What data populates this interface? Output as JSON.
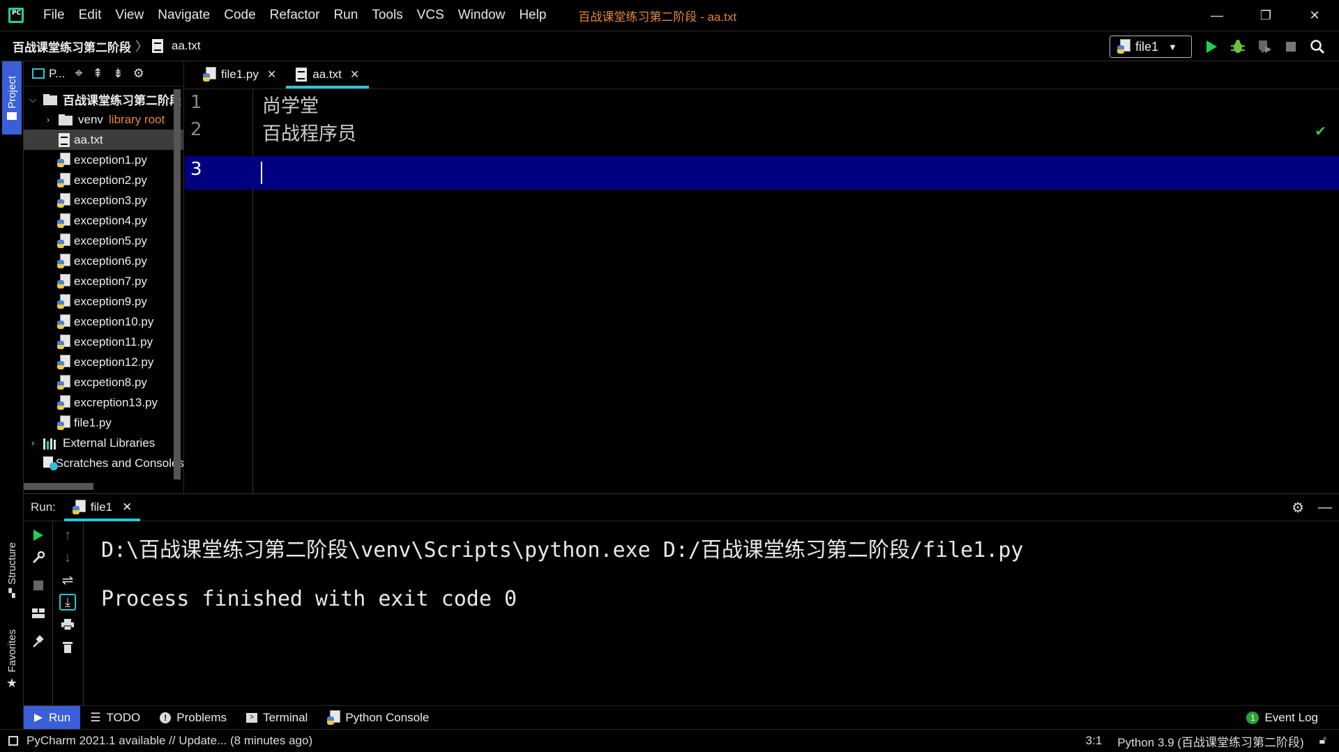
{
  "app": {
    "logo_text": "PC",
    "window_title": "百战课堂练习第二阶段 - aa.txt"
  },
  "menu": [
    "File",
    "Edit",
    "View",
    "Navigate",
    "Code",
    "Refactor",
    "Run",
    "Tools",
    "VCS",
    "Window",
    "Help"
  ],
  "window_controls": {
    "minimize": "—",
    "restore": "❐",
    "close": "✕"
  },
  "breadcrumb": {
    "project": "百战课堂练习第二阶段",
    "file": "aa.txt"
  },
  "run_config": {
    "name": "file1"
  },
  "left_stripe": {
    "project": "Project",
    "structure": "Structure",
    "favorites": "Favorites"
  },
  "project_panel": {
    "view_label": "P...",
    "tree": [
      {
        "label": "百战课堂练习第二阶段",
        "type": "folder",
        "expanded": true
      },
      {
        "label": "venv",
        "suffix": "library root",
        "type": "folder",
        "expanded": false
      },
      {
        "label": "aa.txt",
        "type": "txt",
        "selected": true
      },
      {
        "label": "exception1.py",
        "type": "py"
      },
      {
        "label": "exception2.py",
        "type": "py"
      },
      {
        "label": "exception3.py",
        "type": "py"
      },
      {
        "label": "exception4.py",
        "type": "py"
      },
      {
        "label": "exception5.py",
        "type": "py"
      },
      {
        "label": "exception6.py",
        "type": "py"
      },
      {
        "label": "exception7.py",
        "type": "py"
      },
      {
        "label": "exception9.py",
        "type": "py"
      },
      {
        "label": "exception10.py",
        "type": "py"
      },
      {
        "label": "exception11.py",
        "type": "py"
      },
      {
        "label": "exception12.py",
        "type": "py"
      },
      {
        "label": "excpetion8.py",
        "type": "py"
      },
      {
        "label": "excreption13.py",
        "type": "py"
      },
      {
        "label": "file1.py",
        "type": "py"
      },
      {
        "label": "External Libraries",
        "type": "lib"
      },
      {
        "label": "Scratches and Consoles",
        "type": "scratch"
      }
    ]
  },
  "editor": {
    "tabs": [
      {
        "label": "file1.py",
        "close": "✕"
      },
      {
        "label": "aa.txt",
        "close": "✕"
      }
    ],
    "line_numbers": [
      "1",
      "2",
      "3"
    ],
    "lines": [
      "尚学堂",
      "百战程序员",
      ""
    ],
    "status_check": "✔"
  },
  "run_panel": {
    "label": "Run:",
    "tab": "file1",
    "tab_close": "✕",
    "console": [
      "D:\\百战课堂练习第二阶段\\venv\\Scripts\\python.exe D:/百战课堂练习第二阶段/file1.py",
      "",
      "Process finished with exit code 0"
    ]
  },
  "tool_strip": {
    "run": "Run",
    "todo": "TODO",
    "problems": "Problems",
    "terminal": "Terminal",
    "python_console": "Python Console",
    "event_log": "Event Log",
    "event_count": "1"
  },
  "status_bar": {
    "message": "PyCharm 2021.1 available // Update... (8 minutes ago)",
    "position": "3:1",
    "interpreter": "Python 3.9 (百战课堂练习第二阶段)"
  },
  "colors": {
    "accent_tab": "#2bc7d4",
    "selected_line": "#000080",
    "active_tool": "#3a5fd8",
    "run_green": "#21d05a",
    "library_root": "#e8873a"
  }
}
